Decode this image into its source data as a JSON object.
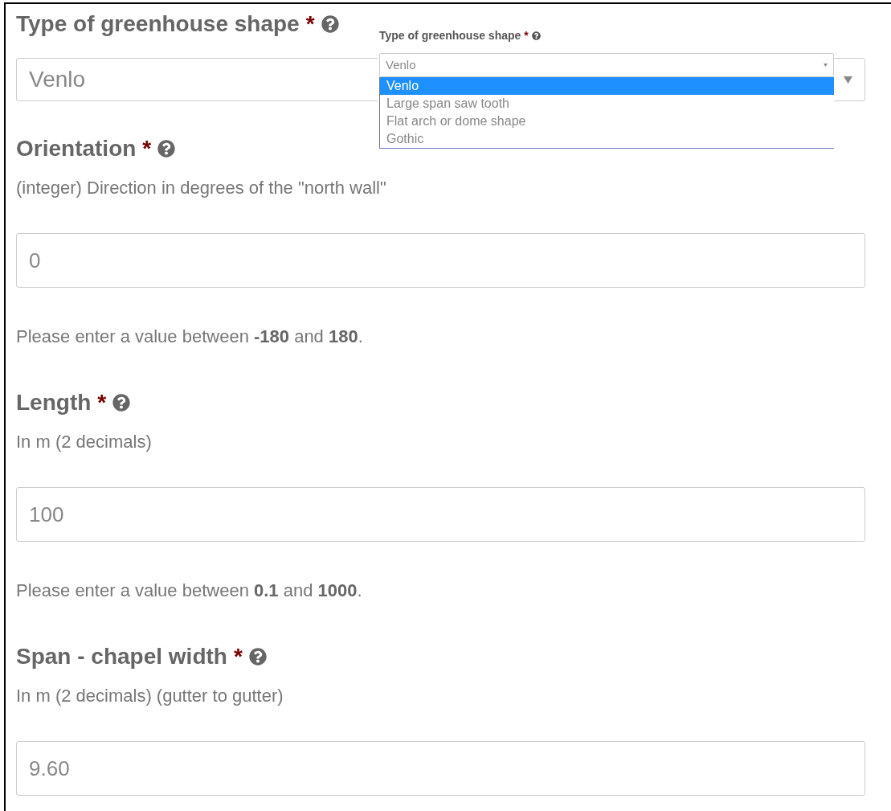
{
  "fields": [
    {
      "kind": "select",
      "label": "Type of greenhouse shape",
      "marker": "*",
      "value": "Venlo"
    },
    {
      "kind": "input",
      "label": "Orientation",
      "marker": "*",
      "description": "(integer) Direction in degrees of the \"north wall\"",
      "value": "0",
      "hint": "Please enter a value between **-180** and **180**."
    },
    {
      "kind": "input",
      "label": "Length",
      "marker": "*",
      "description": "In m (2 decimals)",
      "value": "100",
      "hint": "Please enter a value between **0.1** and **1000**."
    },
    {
      "kind": "input",
      "label": "Span - chapel width",
      "marker": "*",
      "description": "In m (2 decimals) (gutter to gutter)",
      "value": "9.60"
    }
  ],
  "dropdown": {
    "label": "Type of greenhouse shape",
    "marker": "*",
    "value": "Venlo",
    "options": [
      {
        "label": "Venlo",
        "selected": true
      },
      {
        "label": "Large span saw tooth",
        "selected": false
      },
      {
        "label": "Flat arch or dome shape",
        "selected": false
      },
      {
        "label": "Gothic",
        "selected": false
      }
    ]
  }
}
